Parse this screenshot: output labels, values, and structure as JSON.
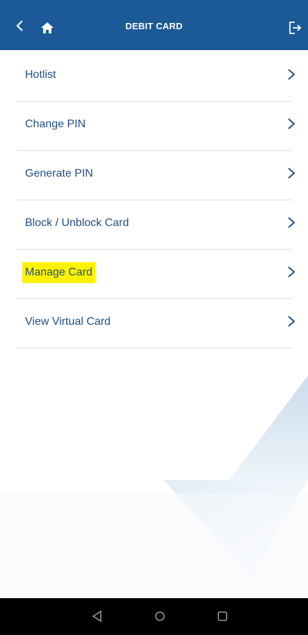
{
  "header": {
    "title": "DEBIT CARD",
    "back_icon": "chevron-left-icon",
    "home_icon": "home-icon",
    "logout_icon": "logout-icon"
  },
  "menu": {
    "items": [
      {
        "label": "Hotlist"
      },
      {
        "label": "Change PIN"
      },
      {
        "label": "Generate PIN"
      },
      {
        "label": "Block / Unblock Card"
      },
      {
        "label": "Manage Card",
        "highlighted": true
      },
      {
        "label": "View Virtual Card"
      }
    ]
  },
  "system_nav": {
    "back_icon": "triangle-back-icon",
    "home_icon": "circle-home-icon",
    "recents_icon": "square-recents-icon"
  },
  "colors": {
    "header_bg": "#1b5a96",
    "label_text": "#1f4f80",
    "highlight": "#fff200"
  }
}
